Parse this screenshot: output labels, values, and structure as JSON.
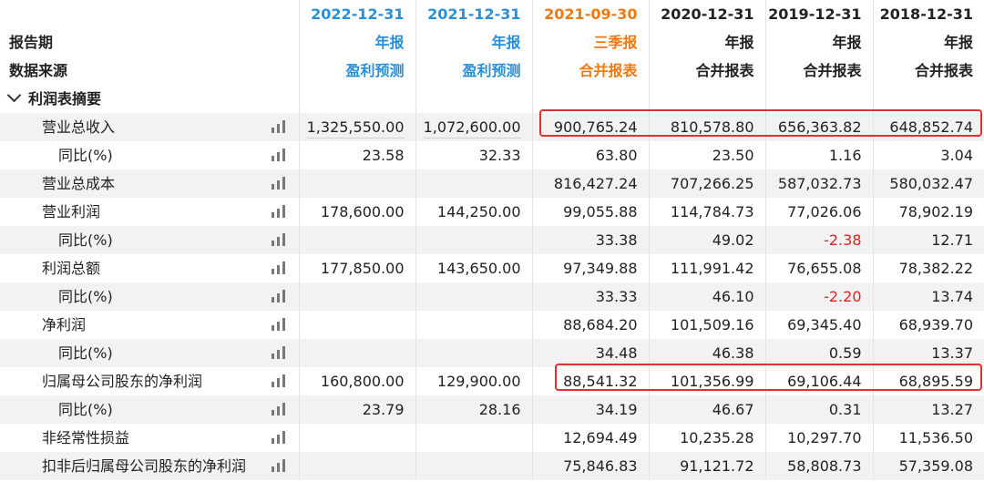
{
  "header": {
    "periods": [
      {
        "date": "2022-12-31",
        "type": "年报",
        "source": "盈利预测",
        "color": "blue"
      },
      {
        "date": "2021-12-31",
        "type": "年报",
        "source": "盈利预测",
        "color": "blue"
      },
      {
        "date": "2021-09-30",
        "type": "三季报",
        "source": "合并报表",
        "color": "orange"
      },
      {
        "date": "2020-12-31",
        "type": "年报",
        "source": "合并报表",
        "color": "dark"
      },
      {
        "date": "2019-12-31",
        "type": "年报",
        "source": "合并报表",
        "color": "dark"
      },
      {
        "date": "2018-12-31",
        "type": "年报",
        "source": "合并报表",
        "color": "dark"
      }
    ],
    "report_period_label": "报告期",
    "data_source_label": "数据来源"
  },
  "section_title": "利润表摘要",
  "rows": [
    {
      "label": "营业总收入",
      "indent": 1,
      "values": [
        "1,325,550.00",
        "1,072,600.00",
        "900,765.24",
        "810,578.80",
        "656,363.82",
        "648,852.74"
      ]
    },
    {
      "label": "同比(%)",
      "indent": 2,
      "values": [
        "23.58",
        "32.33",
        "63.80",
        "23.50",
        "1.16",
        "3.04"
      ]
    },
    {
      "label": "营业总成本",
      "indent": 1,
      "values": [
        "",
        "",
        "816,427.24",
        "707,266.25",
        "587,032.73",
        "580,032.47"
      ]
    },
    {
      "label": "营业利润",
      "indent": 1,
      "values": [
        "178,600.00",
        "144,250.00",
        "99,055.88",
        "114,784.73",
        "77,026.06",
        "78,902.19"
      ]
    },
    {
      "label": "同比(%)",
      "indent": 2,
      "values": [
        "",
        "",
        "33.38",
        "49.02",
        "-2.38",
        "12.71"
      ]
    },
    {
      "label": "利润总额",
      "indent": 1,
      "values": [
        "177,850.00",
        "143,650.00",
        "97,349.88",
        "111,991.42",
        "76,655.08",
        "78,382.22"
      ]
    },
    {
      "label": "同比(%)",
      "indent": 2,
      "values": [
        "",
        "",
        "33.33",
        "46.10",
        "-2.20",
        "13.74"
      ]
    },
    {
      "label": "净利润",
      "indent": 1,
      "values": [
        "",
        "",
        "88,684.20",
        "101,509.16",
        "69,345.40",
        "68,939.70"
      ]
    },
    {
      "label": "同比(%)",
      "indent": 2,
      "values": [
        "",
        "",
        "34.48",
        "46.38",
        "0.59",
        "13.37"
      ]
    },
    {
      "label": "归属母公司股东的净利润",
      "indent": 1,
      "values": [
        "160,800.00",
        "129,900.00",
        "88,541.32",
        "101,356.99",
        "69,106.44",
        "68,895.59"
      ]
    },
    {
      "label": "同比(%)",
      "indent": 2,
      "values": [
        "23.79",
        "28.16",
        "34.19",
        "46.67",
        "0.31",
        "13.27"
      ]
    },
    {
      "label": "非经常性损益",
      "indent": 1,
      "values": [
        "",
        "",
        "12,694.49",
        "10,235.28",
        "10,297.70",
        "11,536.50"
      ]
    },
    {
      "label": "扣非后归属母公司股东的净利润",
      "indent": 1,
      "values": [
        "",
        "",
        "75,846.83",
        "91,121.72",
        "58,808.73",
        "57,359.08"
      ]
    }
  ],
  "colors": {
    "blue": "#2a8fd6",
    "orange": "#f07a12",
    "negative": "#e02020",
    "highlight": "#e23030"
  },
  "icons": {
    "row_chart": "bar-chart-icon",
    "section_toggle": "chevron-down-icon"
  }
}
